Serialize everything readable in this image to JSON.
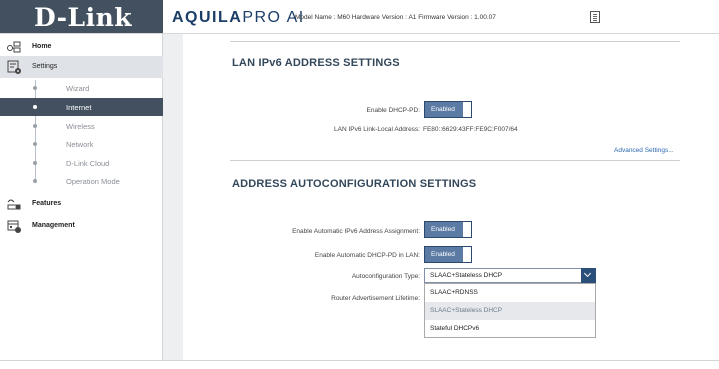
{
  "header": {
    "logo": "D-Link",
    "brand_bold": "AQUILA",
    "brand_rest": "PRO AI",
    "model_info": "Model Name : M60 Hardware Version : A1 Firmware Version : 1.00.07"
  },
  "sidebar": {
    "items": [
      {
        "label": "Home",
        "icon": "home-network-icon"
      },
      {
        "label": "Settings",
        "icon": "settings-gear-icon"
      },
      {
        "label": "Features",
        "icon": "features-icon"
      },
      {
        "label": "Management",
        "icon": "management-icon"
      }
    ],
    "sub_items": [
      {
        "label": "Wizard"
      },
      {
        "label": "Internet"
      },
      {
        "label": "Wireless"
      },
      {
        "label": "Network"
      },
      {
        "label": "D-Link Cloud"
      },
      {
        "label": "Operation Mode"
      }
    ]
  },
  "lan_section": {
    "title": "LAN IPv6 ADDRESS SETTINGS",
    "dhcp_pd_label": "Enable DHCP-PD:",
    "dhcp_pd_value": "Enabled",
    "link_local_label": "LAN IPv6 Link-Local Address:",
    "link_local_value": "FE80::6629:43FF:FE9C:F007/64",
    "advanced_link": "Advanced Settings..."
  },
  "auto_section": {
    "title": "ADDRESS AUTOCONFIGURATION SETTINGS",
    "auto_assign_label": "Enable Automatic IPv6 Address Assignment:",
    "auto_assign_value": "Enabled",
    "auto_dhcp_pd_label": "Enable Automatic DHCP-PD in LAN:",
    "auto_dhcp_pd_value": "Enabled",
    "type_label": "Autoconfiguration Type:",
    "type_selected": "SLAAC+Stateless DHCP",
    "type_options": [
      "SLAAC+RDNSS",
      "SLAAC+Stateless DHCP",
      "Stateful DHCPv6"
    ],
    "lifetime_label": "Router Advertisement Lifetime:"
  },
  "colors": {
    "sidebar_active": "#43505f",
    "toggle_on": "#5b7ba5",
    "select_button": "#2b4f7b",
    "link": "#2c69b0"
  }
}
